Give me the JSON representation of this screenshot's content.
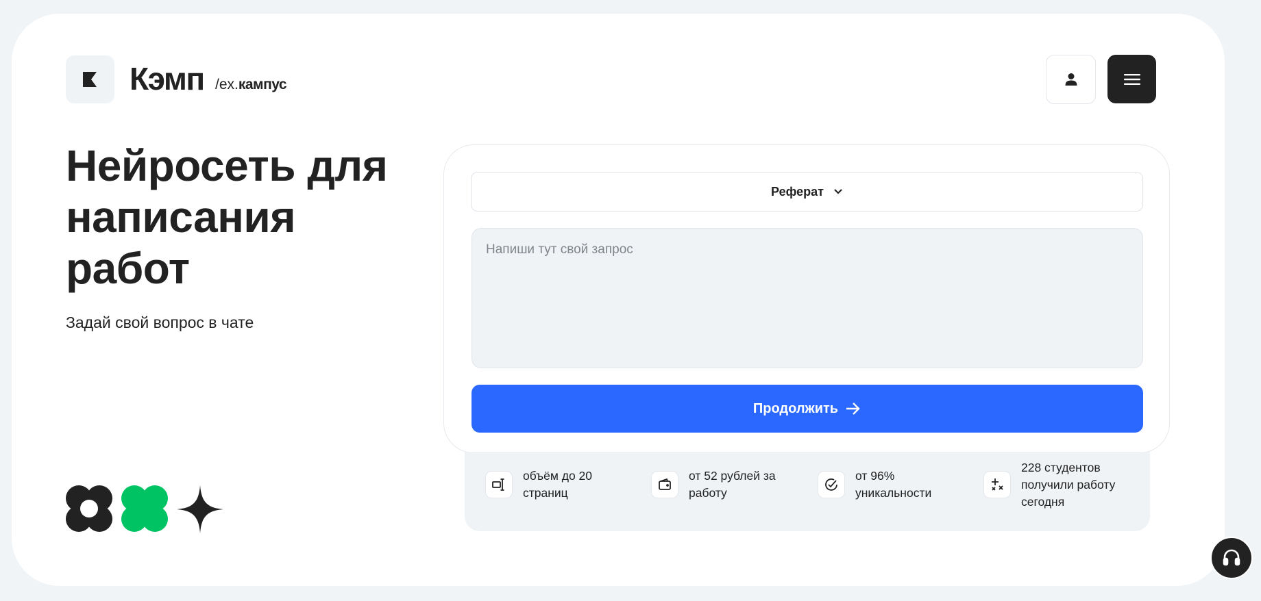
{
  "brand": {
    "name": "Кэмп",
    "ex_prefix": "/ex.",
    "ex_name": "кампус"
  },
  "header": {
    "user_icon": "user-icon",
    "menu_icon": "hamburger-menu-icon"
  },
  "hero": {
    "title_line1": "Нейросеть для",
    "title_line2": "написания",
    "title_line3": "работ",
    "subtitle": "Задай свой вопрос в чате"
  },
  "form": {
    "work_type": "Реферат",
    "request_placeholder": "Напиши тут свой запрос",
    "request_value": "",
    "continue_label": "Продолжить"
  },
  "stats": [
    {
      "icon": "text-size-icon",
      "text": "объём до 20 страниц"
    },
    {
      "icon": "wallet-icon",
      "text": "от 52 рублей за работу"
    },
    {
      "icon": "check-circle-icon",
      "text": "от 96% уникальности"
    },
    {
      "icon": "sparkles-icon",
      "text": "228 студентов получили работу сегодня"
    }
  ],
  "colors": {
    "accent": "#2a68ff",
    "dark": "#222222",
    "green": "#00c464",
    "panel": "#f0f3f6"
  },
  "support": {
    "icon": "headset-icon"
  }
}
